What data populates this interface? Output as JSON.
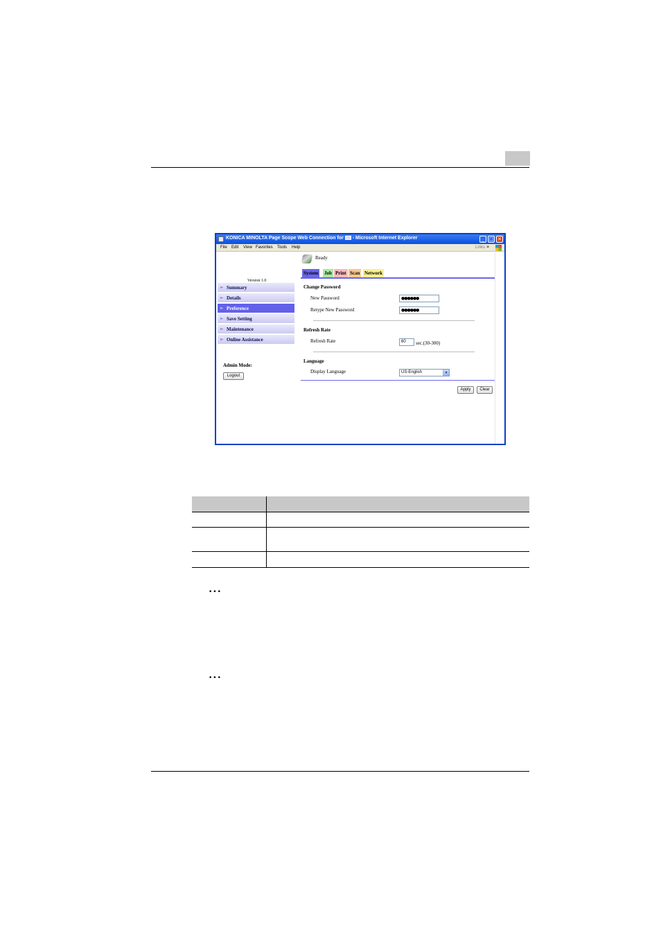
{
  "window": {
    "title": "KONICA MINOLTA Page Scope Web Connection for ",
    "title_suffix": " - Microsoft Internet Explorer",
    "buttons": {
      "minimize": "_",
      "maximize": "□",
      "close": "✕"
    }
  },
  "menubar": {
    "items": [
      "File",
      "Edit",
      "View",
      "Favorites",
      "Tools",
      "Help"
    ],
    "links_label": "Links",
    "more_glyph": "»"
  },
  "status": {
    "text": "Ready"
  },
  "version": "Version 1.0",
  "tabs": [
    {
      "label": "System",
      "color": "#6a66e8"
    },
    {
      "label": "Job",
      "color": "#a8e8a0"
    },
    {
      "label": "Print",
      "color": "#f8b8c0"
    },
    {
      "label": "Scan",
      "color": "#f8c890"
    },
    {
      "label": "Network",
      "color": "#f8f090"
    }
  ],
  "sidebar": {
    "items": [
      {
        "label": "Summary",
        "arrow": "►"
      },
      {
        "label": "Details",
        "arrow": "►"
      },
      {
        "label": "Preference",
        "arrow": "►"
      },
      {
        "label": "Save Setting",
        "arrow": "►"
      },
      {
        "label": "Maintenance",
        "arrow": "►"
      },
      {
        "label": "Online Assistance",
        "arrow": "►"
      }
    ],
    "active_index": 2,
    "admin_label": "Admin Mode:",
    "logout_label": "Logout"
  },
  "form": {
    "change_password": {
      "title": "Change Password",
      "new_label": "New Password",
      "new_value": "●●●●●●",
      "retype_label": "Retype New Password",
      "retype_value": "●●●●●●"
    },
    "refresh_rate": {
      "title": "Refresh Rate",
      "label": "Refresh Rate",
      "value": "60",
      "unit": "sec.(30-300)"
    },
    "language": {
      "title": "Language",
      "label": "Display Language",
      "selected": "US-English",
      "arrow": "▾"
    },
    "apply_label": "Apply",
    "clear_label": "Clear"
  },
  "notes": {
    "dots_1": "•••",
    "dots_2": "•••"
  },
  "colors": {
    "window_border": "#0a3fc6",
    "active_nav": "#6361ea"
  }
}
